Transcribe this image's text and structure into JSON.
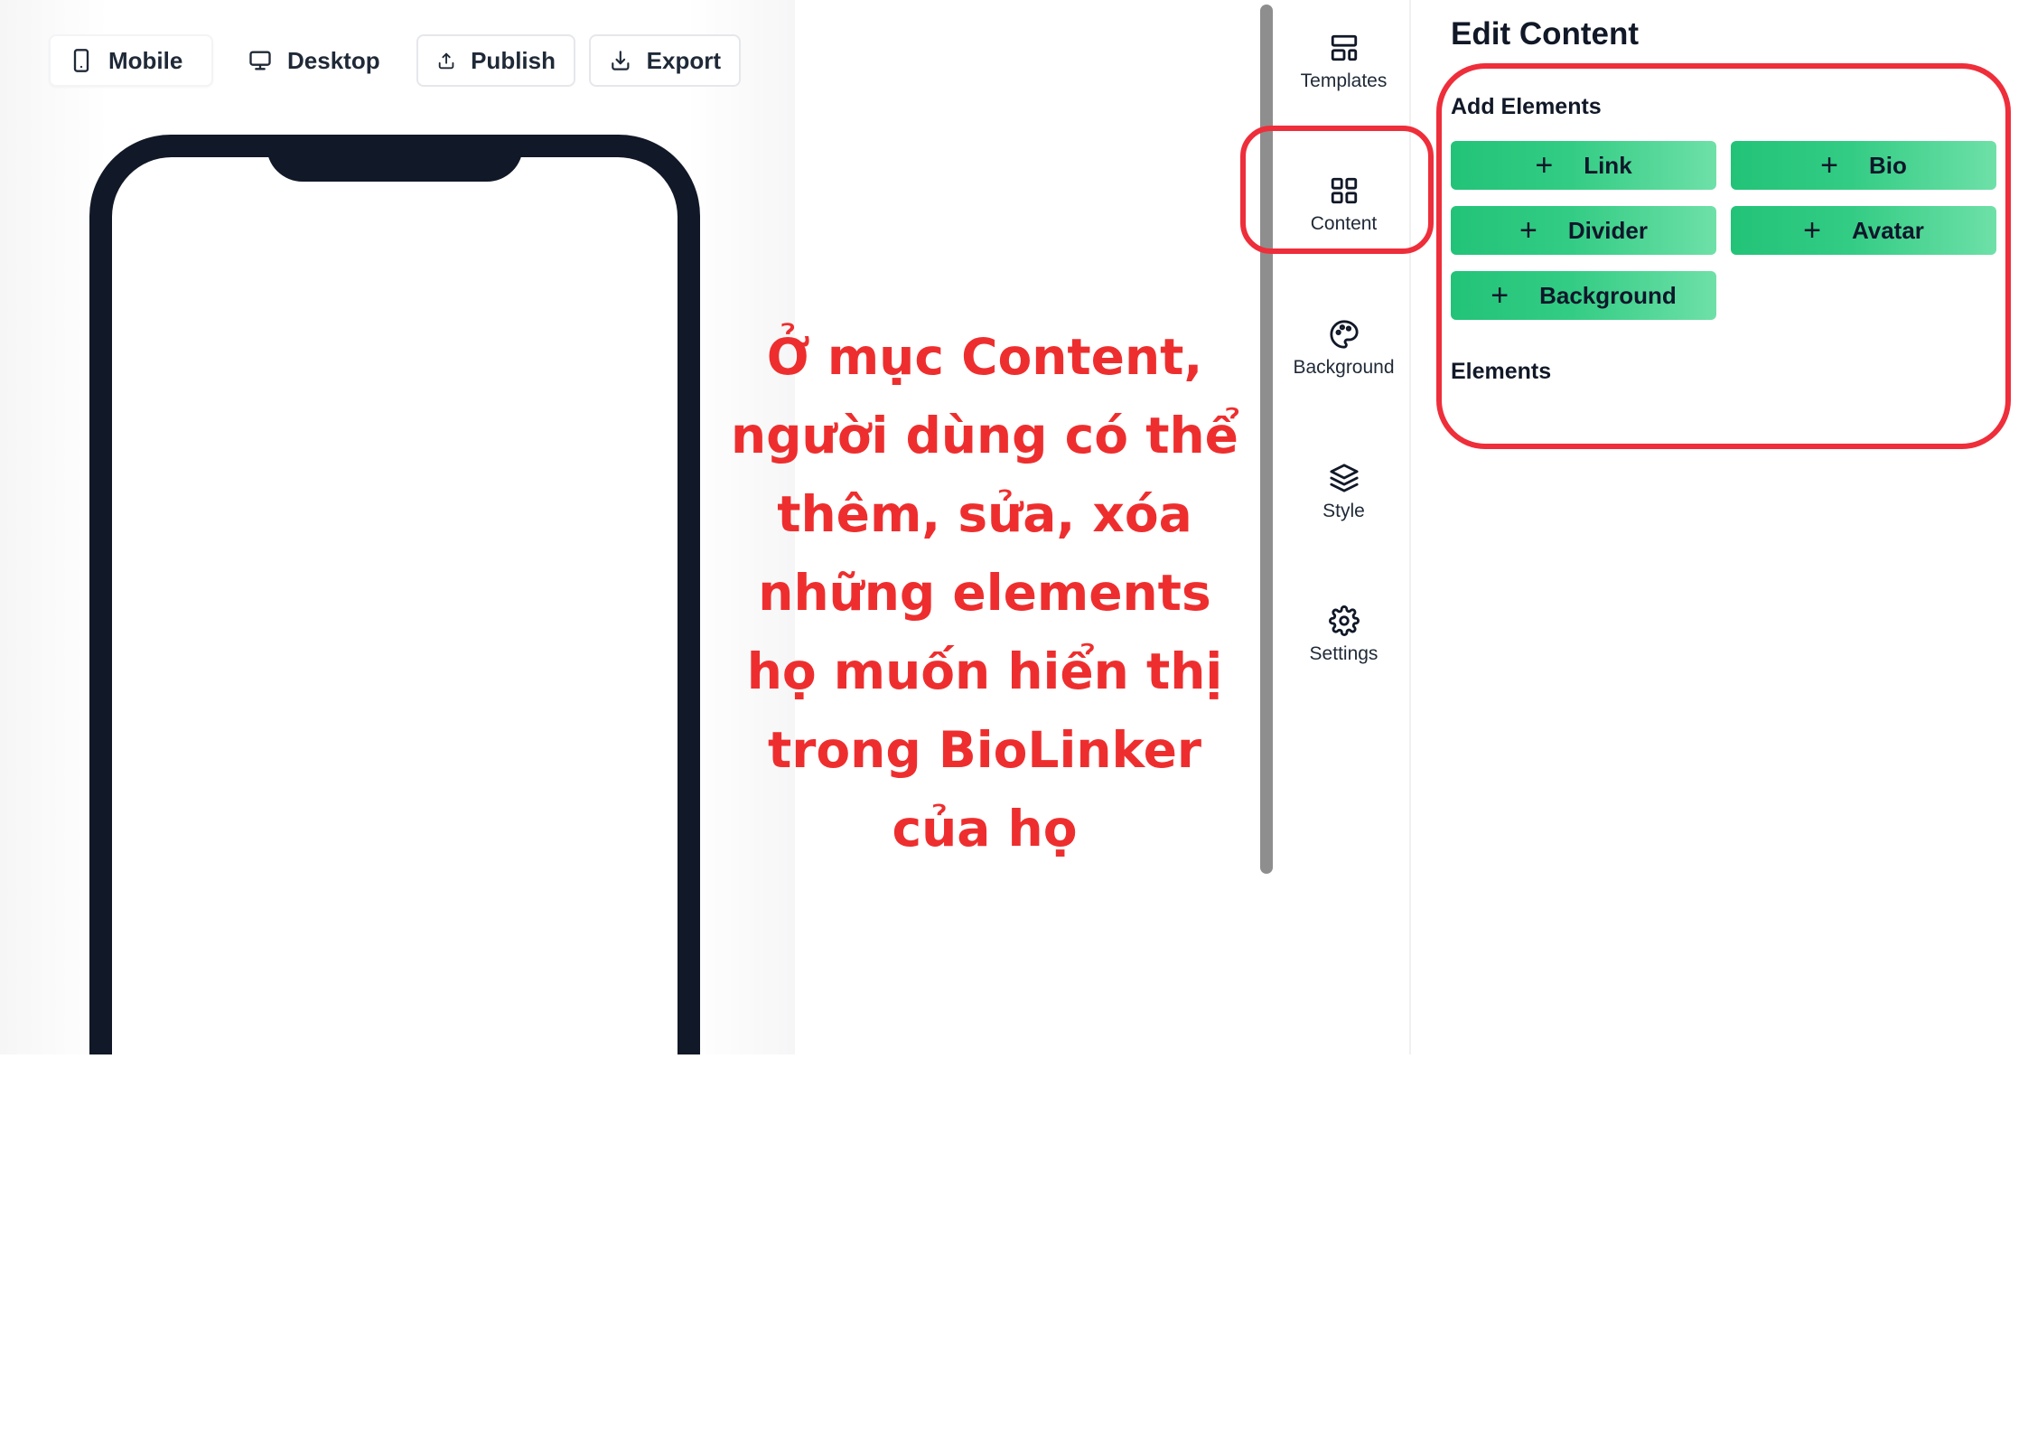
{
  "toolbar": {
    "mobile": "Mobile",
    "desktop": "Desktop",
    "publish": "Publish",
    "export": "Export"
  },
  "annotation": {
    "lines": [
      "Ở mục Content,",
      "người dùng có thể",
      "thêm, sửa, xóa",
      "những elements",
      "họ muốn hiển thị",
      "trong BioLinker",
      "của họ"
    ],
    "color": "#ee2e2e"
  },
  "nav": {
    "items": [
      {
        "label": "Templates",
        "icon": "layout-template-icon"
      },
      {
        "label": "Content",
        "icon": "grid-icon"
      },
      {
        "label": "Background",
        "icon": "palette-icon"
      },
      {
        "label": "Style",
        "icon": "layers-icon"
      },
      {
        "label": "Settings",
        "icon": "gear-icon"
      }
    ],
    "active": "Content"
  },
  "panel": {
    "title": "Edit Content",
    "add_elements_title": "Add Elements",
    "buttons": {
      "link": "Link",
      "bio": "Bio",
      "divider": "Divider",
      "avatar": "Avatar",
      "background": "Background"
    },
    "plus_symbol": "+",
    "elements_title": "Elements"
  },
  "colors": {
    "accent_green": "#22c378",
    "annotation_red": "#ee2e3a",
    "phone_frame": "#111827"
  }
}
